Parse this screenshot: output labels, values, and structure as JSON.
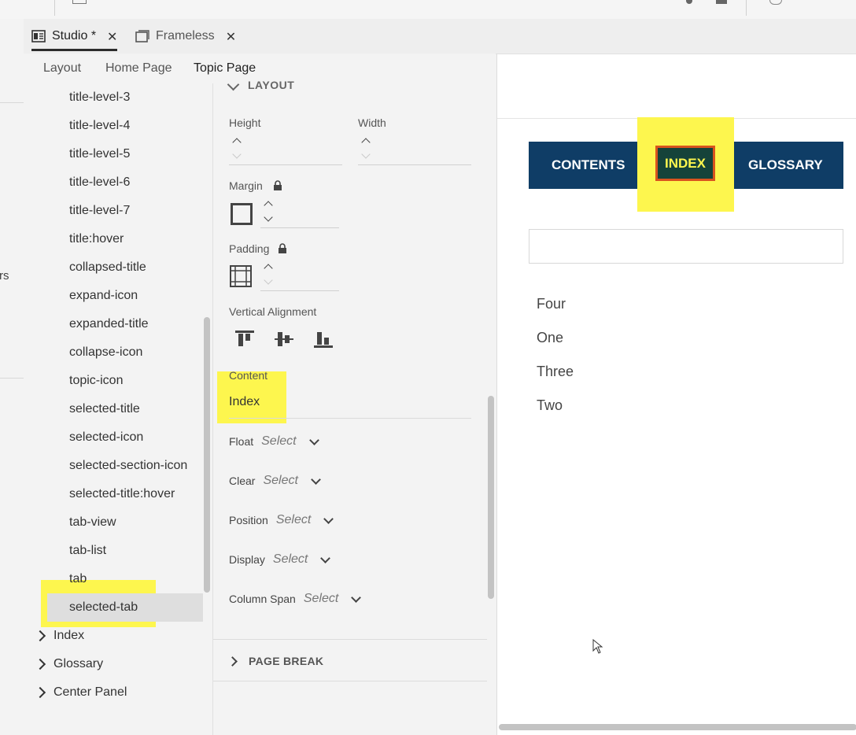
{
  "doc_tabs": [
    {
      "label": "Studio *",
      "close": "✕"
    },
    {
      "label": "Frameless",
      "close": "✕"
    }
  ],
  "subtabs": [
    "Layout",
    "Home Page",
    "Topic Page"
  ],
  "tree": {
    "items": [
      "title-level-3",
      "title-level-4",
      "title-level-5",
      "title-level-6",
      "title-level-7",
      "title:hover",
      "collapsed-title",
      "expand-icon",
      "expanded-title",
      "collapse-icon",
      "topic-icon",
      "selected-title",
      "selected-icon",
      "selected-section-icon",
      "selected-title:hover",
      "tab-view",
      "tab-list",
      "tab",
      "selected-tab"
    ],
    "groups": [
      "Index",
      "Glossary",
      "Center Panel"
    ],
    "selected": "selected-tab"
  },
  "left_edge_text": "rs",
  "props": {
    "layout_header": "LAYOUT",
    "height_label": "Height",
    "width_label": "Width",
    "margin_label": "Margin",
    "padding_label": "Padding",
    "valign_label": "Vertical Alignment",
    "content_label": "Content",
    "content_value": "Index",
    "dropdowns": [
      {
        "label": "Float",
        "value": "Select"
      },
      {
        "label": "Clear",
        "value": "Select"
      },
      {
        "label": "Position",
        "value": "Select"
      },
      {
        "label": "Display",
        "value": "Select"
      },
      {
        "label": "Column Span",
        "value": "Select"
      }
    ],
    "page_break": "PAGE BREAK"
  },
  "preview": {
    "nav": [
      "CONTENTS",
      "INDEX",
      "GLOSSARY"
    ],
    "active_nav": "INDEX",
    "index_items": [
      "Four",
      "One",
      "Three",
      "Two"
    ]
  },
  "colors": {
    "highlight": "#fdf64e",
    "nav_bg": "#0f3d66",
    "active_nav_border": "#d9541e",
    "active_nav_text": "#fdf64e"
  }
}
